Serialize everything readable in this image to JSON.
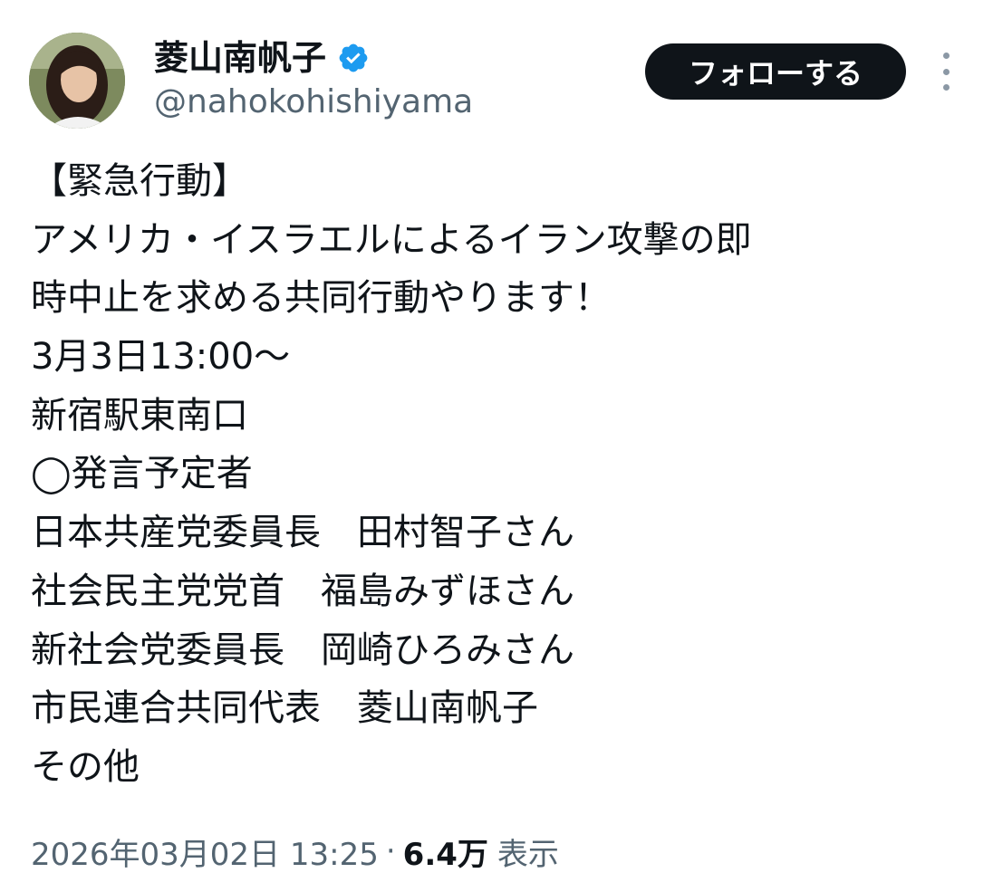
{
  "author": {
    "display_name": "菱山南帆子",
    "handle": "@nahokohishiyama",
    "verified": true
  },
  "actions": {
    "follow_label": "フォローする"
  },
  "post": {
    "lines": [
      "【緊急行動】",
      "アメリカ・イスラエルによるイラン攻撃の即",
      "時中止を求める共同行動やります！",
      "3月3日13:00〜",
      "新宿駅東南口",
      "◯発言予定者",
      "日本共産党委員長　田村智子さん",
      "社会民主党党首　福島みずほさん",
      "新社会党委員長　岡崎ひろみさん",
      "市民連合共同代表　菱山南帆子",
      "その他"
    ]
  },
  "meta": {
    "timestamp": "2026年03月02日 13:25",
    "separator": "·",
    "views_count": "6.4万",
    "views_label": "表示"
  },
  "colors": {
    "verified_badge": "#1d9bf0",
    "follow_button_bg": "#0f1419",
    "secondary_text": "#536471"
  }
}
